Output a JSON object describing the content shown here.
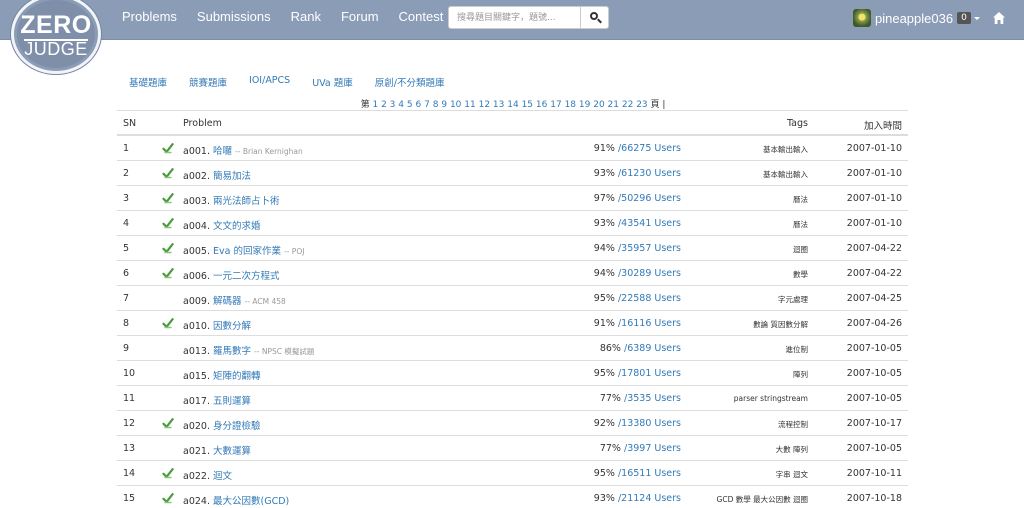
{
  "logo": {
    "line1": "ZERO",
    "line2": "JUDGE"
  },
  "nav": {
    "items": [
      "Problems",
      "Submissions",
      "Rank",
      "Forum",
      "Contest"
    ]
  },
  "search": {
    "placeholder": "搜尋題目關鍵字，題號..."
  },
  "user": {
    "name": "pineapple036",
    "count": "0"
  },
  "categories": [
    "基礎題庫",
    "競賽題庫",
    "IOI/APCS",
    "UVa 題庫",
    "原創/不分類題庫"
  ],
  "pager": {
    "prefix": "第",
    "pages": [
      "1",
      "2",
      "3",
      "4",
      "5",
      "6",
      "7",
      "8",
      "9",
      "10",
      "11",
      "12",
      "13",
      "14",
      "15",
      "16",
      "17",
      "18",
      "19",
      "20",
      "21",
      "22",
      "23"
    ],
    "suffix": "頁 |"
  },
  "table": {
    "headers": {
      "sn": "SN",
      "problem": "Problem",
      "tags": "Tags",
      "date": "加入時間"
    },
    "rows": [
      {
        "sn": "1",
        "solved": true,
        "id": "a001.",
        "title": "哈囉",
        "author": "-- Brian Kernighan",
        "pct": "91%",
        "users": "/66275 Users",
        "tags": "基本輸出輸入",
        "date": "2007-01-10"
      },
      {
        "sn": "2",
        "solved": true,
        "id": "a002.",
        "title": "簡易加法",
        "author": "",
        "pct": "93%",
        "users": "/61230 Users",
        "tags": "基本輸出輸入",
        "date": "2007-01-10"
      },
      {
        "sn": "3",
        "solved": true,
        "id": "a003.",
        "title": "兩光法師占卜術",
        "author": "",
        "pct": "97%",
        "users": "/50296 Users",
        "tags": "曆法",
        "date": "2007-01-10"
      },
      {
        "sn": "4",
        "solved": true,
        "id": "a004.",
        "title": "文文的求婚",
        "author": "",
        "pct": "93%",
        "users": "/43541 Users",
        "tags": "曆法",
        "date": "2007-01-10"
      },
      {
        "sn": "5",
        "solved": true,
        "id": "a005.",
        "title": "Eva 的回家作業",
        "author": "-- POJ",
        "pct": "94%",
        "users": "/35957 Users",
        "tags": "迴圈",
        "date": "2007-04-22"
      },
      {
        "sn": "6",
        "solved": true,
        "id": "a006.",
        "title": "一元二次方程式",
        "author": "",
        "pct": "94%",
        "users": "/30289 Users",
        "tags": "數學",
        "date": "2007-04-22"
      },
      {
        "sn": "7",
        "solved": false,
        "id": "a009.",
        "title": "解碼器",
        "author": "-- ACM 458",
        "pct": "95%",
        "users": "/22588 Users",
        "tags": "字元處理",
        "date": "2007-04-25"
      },
      {
        "sn": "8",
        "solved": true,
        "id": "a010.",
        "title": "因數分解",
        "author": "",
        "pct": "91%",
        "users": "/16116 Users",
        "tags": "數論 質因數分解",
        "date": "2007-04-26"
      },
      {
        "sn": "9",
        "solved": false,
        "id": "a013.",
        "title": "羅馬數字",
        "author": "-- NPSC 模擬試題",
        "pct": "86%",
        "users": "/6389 Users",
        "tags": "進位制",
        "date": "2007-10-05"
      },
      {
        "sn": "10",
        "solved": false,
        "id": "a015.",
        "title": "矩陣的翻轉",
        "author": "",
        "pct": "95%",
        "users": "/17801 Users",
        "tags": "陣列",
        "date": "2007-10-05"
      },
      {
        "sn": "11",
        "solved": false,
        "id": "a017.",
        "title": "五則運算",
        "author": "",
        "pct": "77%",
        "users": "/3535 Users",
        "tags": "parser stringstream",
        "date": "2007-10-05"
      },
      {
        "sn": "12",
        "solved": true,
        "id": "a020.",
        "title": "身分證檢驗",
        "author": "",
        "pct": "92%",
        "users": "/13380 Users",
        "tags": "流程控制",
        "date": "2007-10-17"
      },
      {
        "sn": "13",
        "solved": false,
        "id": "a021.",
        "title": "大數運算",
        "author": "",
        "pct": "77%",
        "users": "/3997 Users",
        "tags": "大數 陣列",
        "date": "2007-10-05"
      },
      {
        "sn": "14",
        "solved": true,
        "id": "a022.",
        "title": "迴文",
        "author": "",
        "pct": "95%",
        "users": "/16511 Users",
        "tags": "字串 迴文",
        "date": "2007-10-11"
      },
      {
        "sn": "15",
        "solved": true,
        "id": "a024.",
        "title": "最大公因數(GCD)",
        "author": "",
        "pct": "93%",
        "users": "/21124 Users",
        "tags": "GCD 數學 最大公因數 迴圈",
        "date": "2007-10-18"
      }
    ]
  },
  "colors": {
    "navbar": "#8b9cb7",
    "link": "#337ab7",
    "solved": "#5cb85c"
  },
  "icons": {
    "search": "search-icon",
    "home": "home-icon",
    "solved": "check-icon"
  }
}
